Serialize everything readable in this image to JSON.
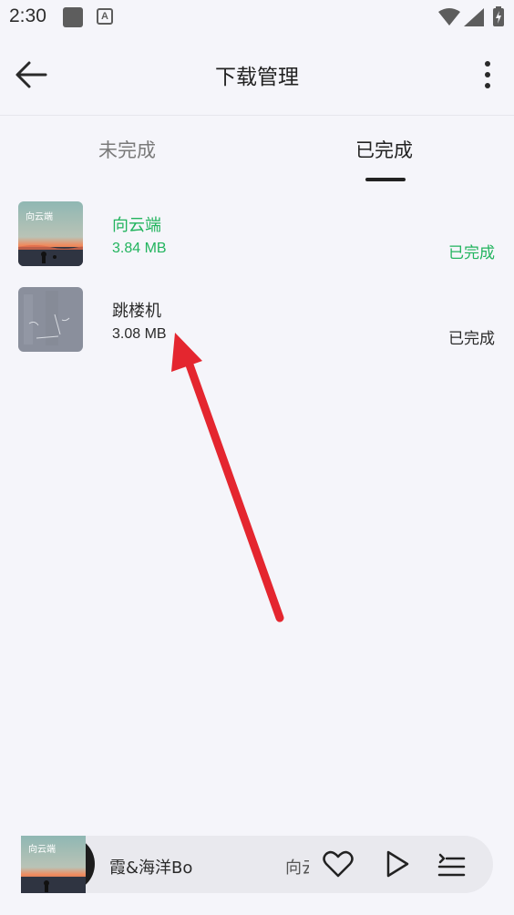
{
  "status_bar": {
    "time": "2:30",
    "notification_icon": "A"
  },
  "header": {
    "title": "下载管理"
  },
  "tabs": [
    {
      "label": "未完成",
      "active": false
    },
    {
      "label": "已完成",
      "active": true
    }
  ],
  "downloads": [
    {
      "title": "向云端",
      "size": "3.84 MB",
      "status": "已完成",
      "highlighted": true,
      "cover_text": "向云端"
    },
    {
      "title": "跳楼机",
      "size": "3.08 MB",
      "status": "已完成",
      "highlighted": false
    }
  ],
  "player": {
    "now_playing": "霞&海洋Bo",
    "next": "向云端"
  },
  "colors": {
    "accent_green": "#22b45e",
    "annotation_arrow": "#e4262f",
    "background": "#f5f5fa"
  }
}
